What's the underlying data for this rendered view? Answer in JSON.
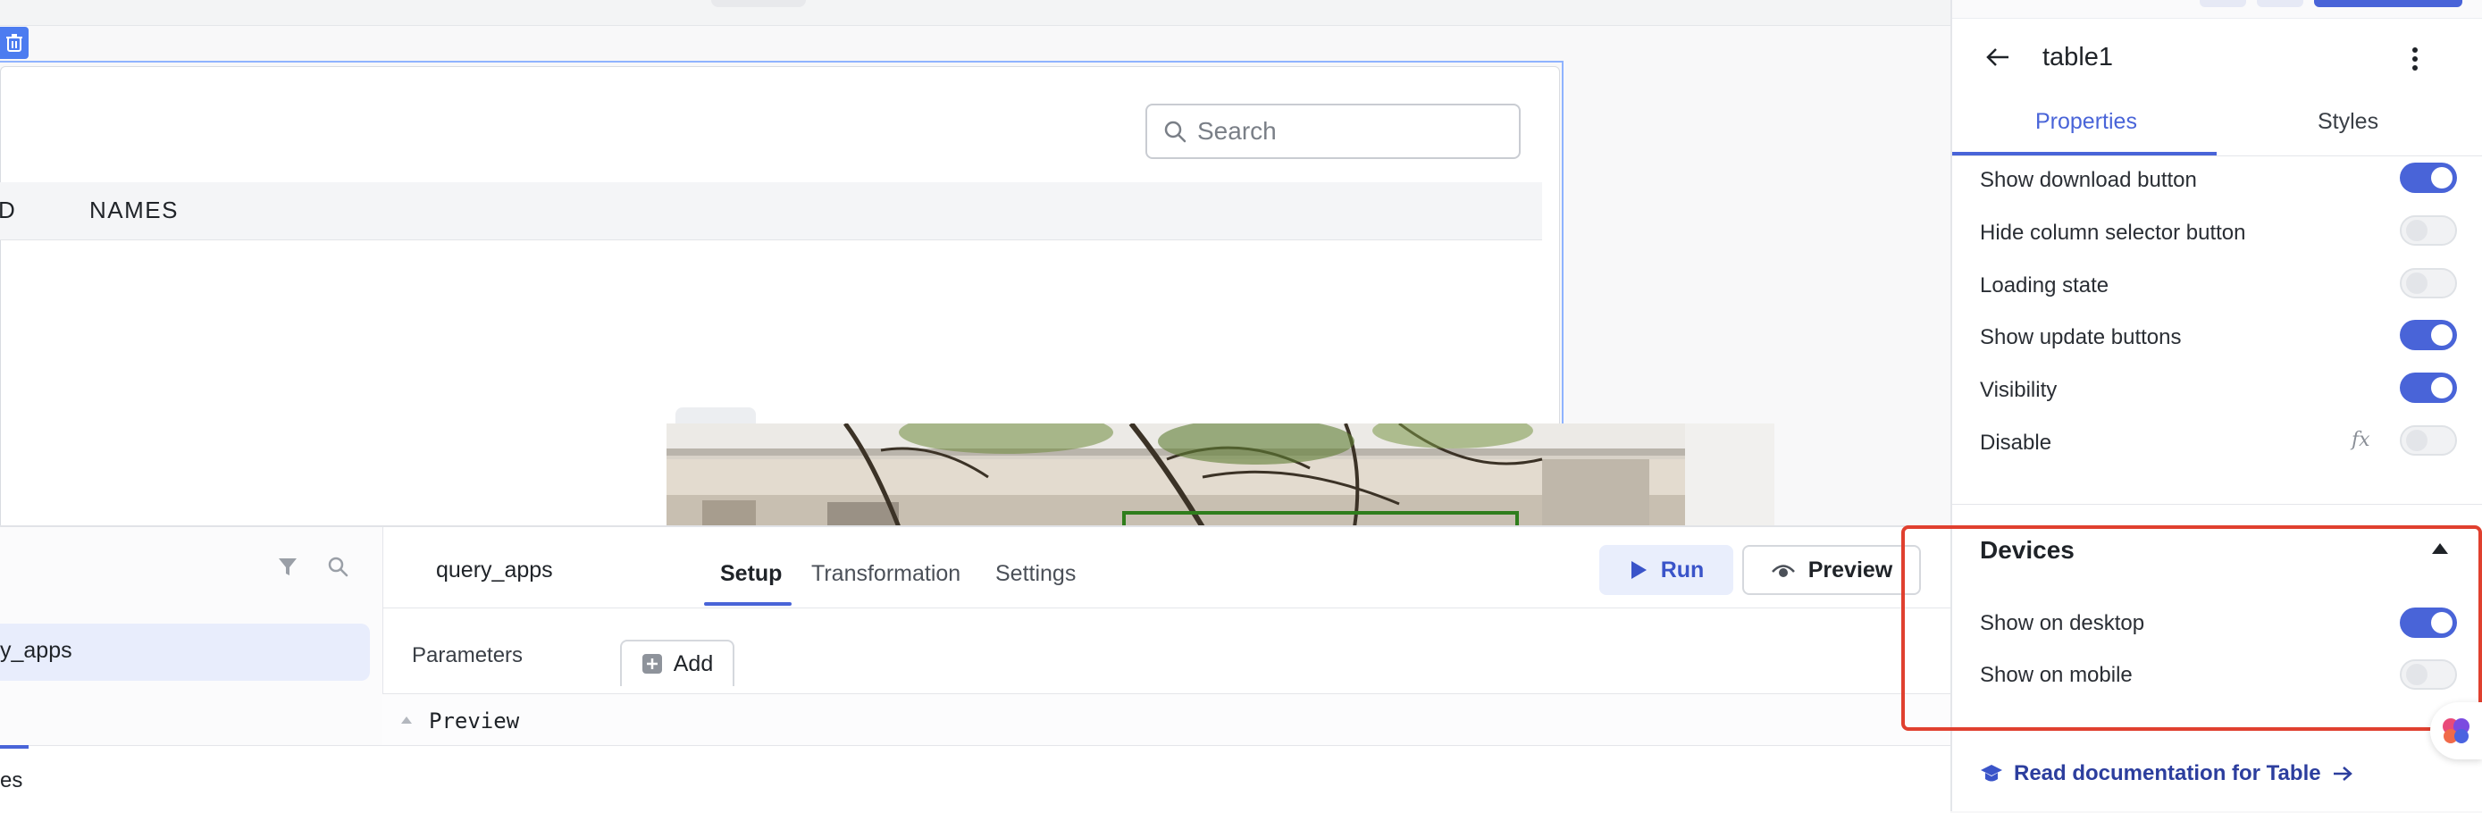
{
  "canvas": {
    "table": {
      "search_placeholder": "Search",
      "columns": [
        "D",
        "NAMES"
      ]
    }
  },
  "query_panel": {
    "query_name": "query_apps",
    "list_item": "y_apps",
    "tabs": [
      "Setup",
      "Transformation",
      "Settings"
    ],
    "active_tab": "Setup",
    "run_label": "Run",
    "preview_label": "Preview",
    "parameters_label": "Parameters",
    "add_label": "Add",
    "preview_section_label": "Preview",
    "bottom_tab_label": "es"
  },
  "properties_panel": {
    "title": "table1",
    "tabs": [
      "Properties",
      "Styles"
    ],
    "active_tab": "Properties",
    "toggles": [
      {
        "label": "Show download button",
        "on": true
      },
      {
        "label": "Hide column selector button",
        "on": false
      },
      {
        "label": "Loading state",
        "on": false
      },
      {
        "label": "Show update buttons",
        "on": true
      },
      {
        "label": "Visibility",
        "on": true
      },
      {
        "label": "Disable",
        "on": false
      }
    ],
    "fx_label": "fx",
    "devices": {
      "title": "Devices",
      "show_on_desktop": {
        "label": "Show on desktop",
        "on": true
      },
      "show_on_mobile": {
        "label": "Show on mobile",
        "on": false
      }
    },
    "doc_link": "Read documentation for Table"
  },
  "colors": {
    "accent": "#4964d8",
    "highlight": "#e0402f"
  }
}
